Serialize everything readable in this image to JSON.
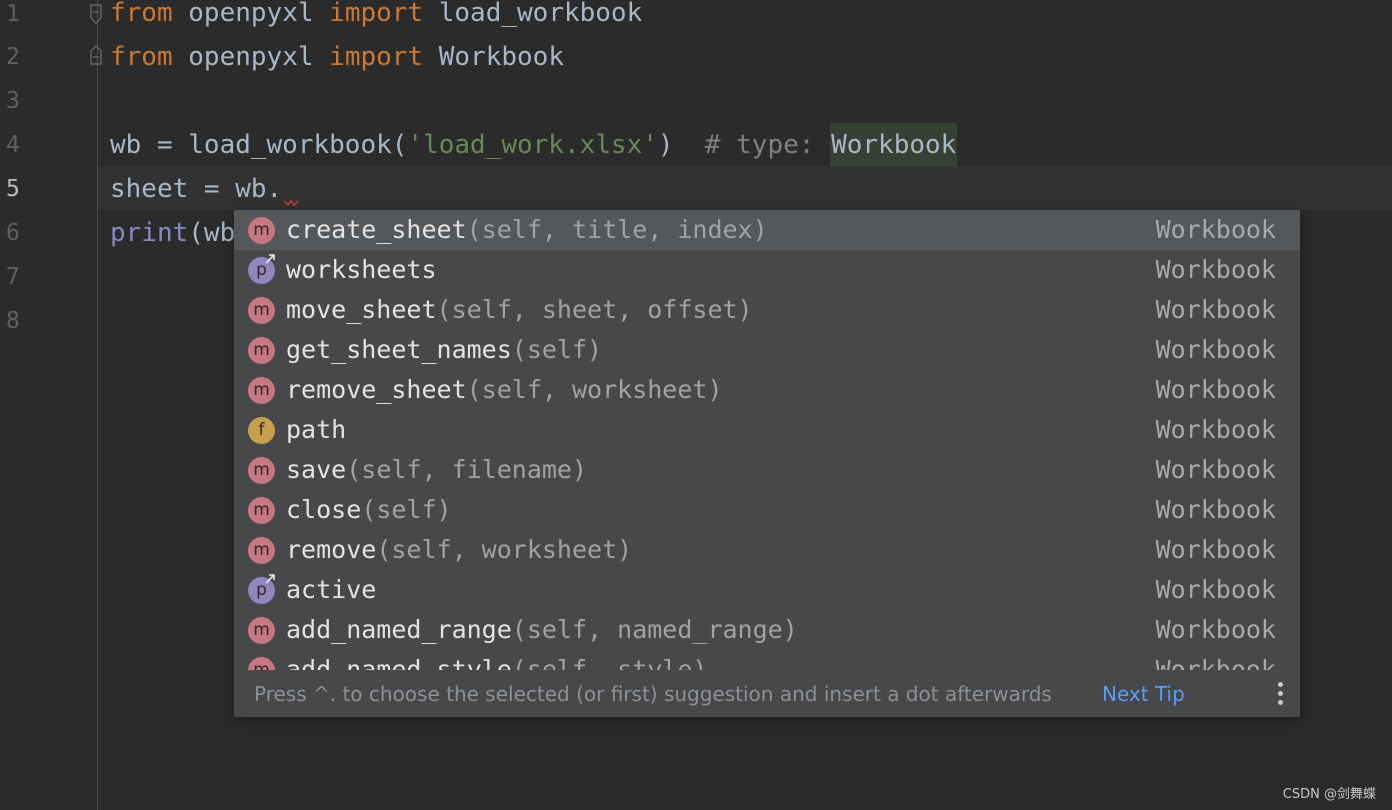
{
  "editor": {
    "line_numbers": [
      "1",
      "2",
      "3",
      "4",
      "5",
      "6",
      "7",
      "8"
    ],
    "current_line": 5,
    "lines": {
      "l1": {
        "kw1": "from",
        "mod": " openpyxl ",
        "kw2": "import",
        "name": " load_workbook"
      },
      "l2": {
        "kw1": "from",
        "mod": " openpyxl ",
        "kw2": "import",
        "name": " Workbook"
      },
      "l4": {
        "prefix": "wb = load_workbook(",
        "str": "'load_work.xlsx'",
        "suffix": ")  ",
        "comment": "# type: ",
        "type_hint": "Workbook"
      },
      "l5": {
        "text": "sheet = wb."
      },
      "l6": {
        "builtin": "print",
        "rest": "(wb"
      }
    }
  },
  "completion": {
    "items": [
      {
        "icon": "m",
        "name": "create_sheet",
        "sig": "(self, title, index)",
        "type": "Workbook",
        "selected": true
      },
      {
        "icon": "p",
        "name": "worksheets",
        "sig": "",
        "type": "Workbook"
      },
      {
        "icon": "m",
        "name": "move_sheet",
        "sig": "(self, sheet, offset)",
        "type": "Workbook"
      },
      {
        "icon": "m",
        "name": "get_sheet_names",
        "sig": "(self)",
        "type": "Workbook"
      },
      {
        "icon": "m",
        "name": "remove_sheet",
        "sig": "(self, worksheet)",
        "type": "Workbook"
      },
      {
        "icon": "f",
        "name": "path",
        "sig": "",
        "type": "Workbook"
      },
      {
        "icon": "m",
        "name": "save",
        "sig": "(self, filename)",
        "type": "Workbook"
      },
      {
        "icon": "m",
        "name": "close",
        "sig": "(self)",
        "type": "Workbook"
      },
      {
        "icon": "m",
        "name": "remove",
        "sig": "(self, worksheet)",
        "type": "Workbook"
      },
      {
        "icon": "p",
        "name": "active",
        "sig": "",
        "type": "Workbook"
      },
      {
        "icon": "m",
        "name": "add_named_range",
        "sig": "(self, named_range)",
        "type": "Workbook"
      },
      {
        "icon": "m",
        "name": "add_named_style",
        "sig": "(self, style)",
        "type": "Workbook"
      }
    ],
    "footer_hint": "Press ^. to choose the selected (or first) suggestion and insert a dot afterwards",
    "next_tip": "Next Tip"
  },
  "watermark": "CSDN @剑舞蝶"
}
